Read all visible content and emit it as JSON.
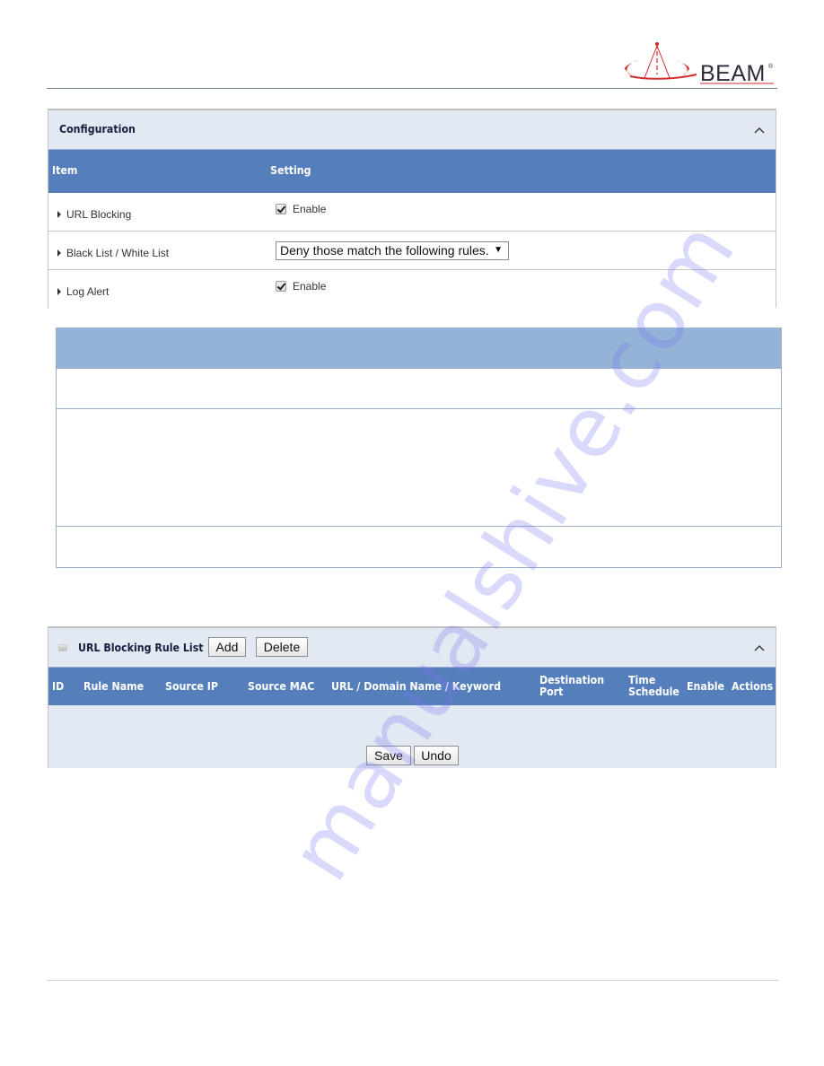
{
  "brand": {
    "logo_text": "BEAM",
    "logo_mark": "®",
    "logo_color": "#d42a2a"
  },
  "config": {
    "title": "Configuration",
    "collapse_icon": "chevron-up-icon",
    "columns": [
      "Item",
      "Setting"
    ],
    "rows": [
      {
        "label": "URL Blocking",
        "type": "checkbox",
        "checked": true,
        "setting": "Enable"
      },
      {
        "label": "Black List / White List",
        "type": "select",
        "setting": "Deny those match the following rules."
      },
      {
        "label": "Log Alert",
        "type": "checkbox",
        "checked": true,
        "setting": "Enable"
      }
    ]
  },
  "rule_list": {
    "title": "URL Blocking Rule List",
    "add_label": "Add",
    "delete_label": "Delete",
    "columns": [
      "ID",
      "Rule Name",
      "Source IP",
      "Source MAC",
      "URL / Domain Name / Keyword",
      "Destination Port",
      "Time Schedule",
      "Enable",
      "Actions"
    ],
    "columns_display": {
      "id": "ID",
      "rule_name": "Rule Name",
      "source_ip": "Source IP",
      "source_mac": "Source MAC",
      "url": "URL / Domain Name / Keyword",
      "dest_port_1": "Destination",
      "dest_port_2": "Port",
      "time_schedule_1": "Time",
      "time_schedule_2": "Schedule",
      "enable": "Enable",
      "actions": "Actions"
    },
    "rows": [],
    "save_label": "Save",
    "undo_label": "Undo"
  },
  "watermark": "manualshive.com",
  "colors": {
    "header_blue": "#557fba",
    "title_bar_bg": "#e3e9f3",
    "desc_head_blue": "#95b3d7"
  }
}
